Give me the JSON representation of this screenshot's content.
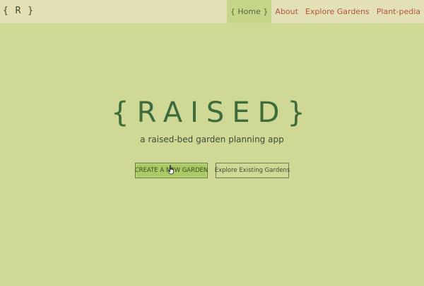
{
  "navbar": {
    "brand": "{ R }",
    "links": [
      {
        "label": "{ Home }",
        "active": true
      },
      {
        "label": "About",
        "active": false
      },
      {
        "label": "Explore Gardens",
        "active": false
      },
      {
        "label": "Plant-pedia",
        "active": false
      }
    ]
  },
  "hero": {
    "title": "{RAISED}",
    "subtitle": "a raised-bed garden planning app",
    "create_button": "CREATE A NEW GARDEN",
    "explore_button": "Explore Existing Gardens"
  },
  "colors": {
    "background": "#cfd995",
    "navbar": "#e3e0b5",
    "link": "#b0553c",
    "title": "#3d6b3c",
    "create_button_bg": "#abc964"
  },
  "icons": {
    "cursor": "hand-pointer-icon"
  }
}
